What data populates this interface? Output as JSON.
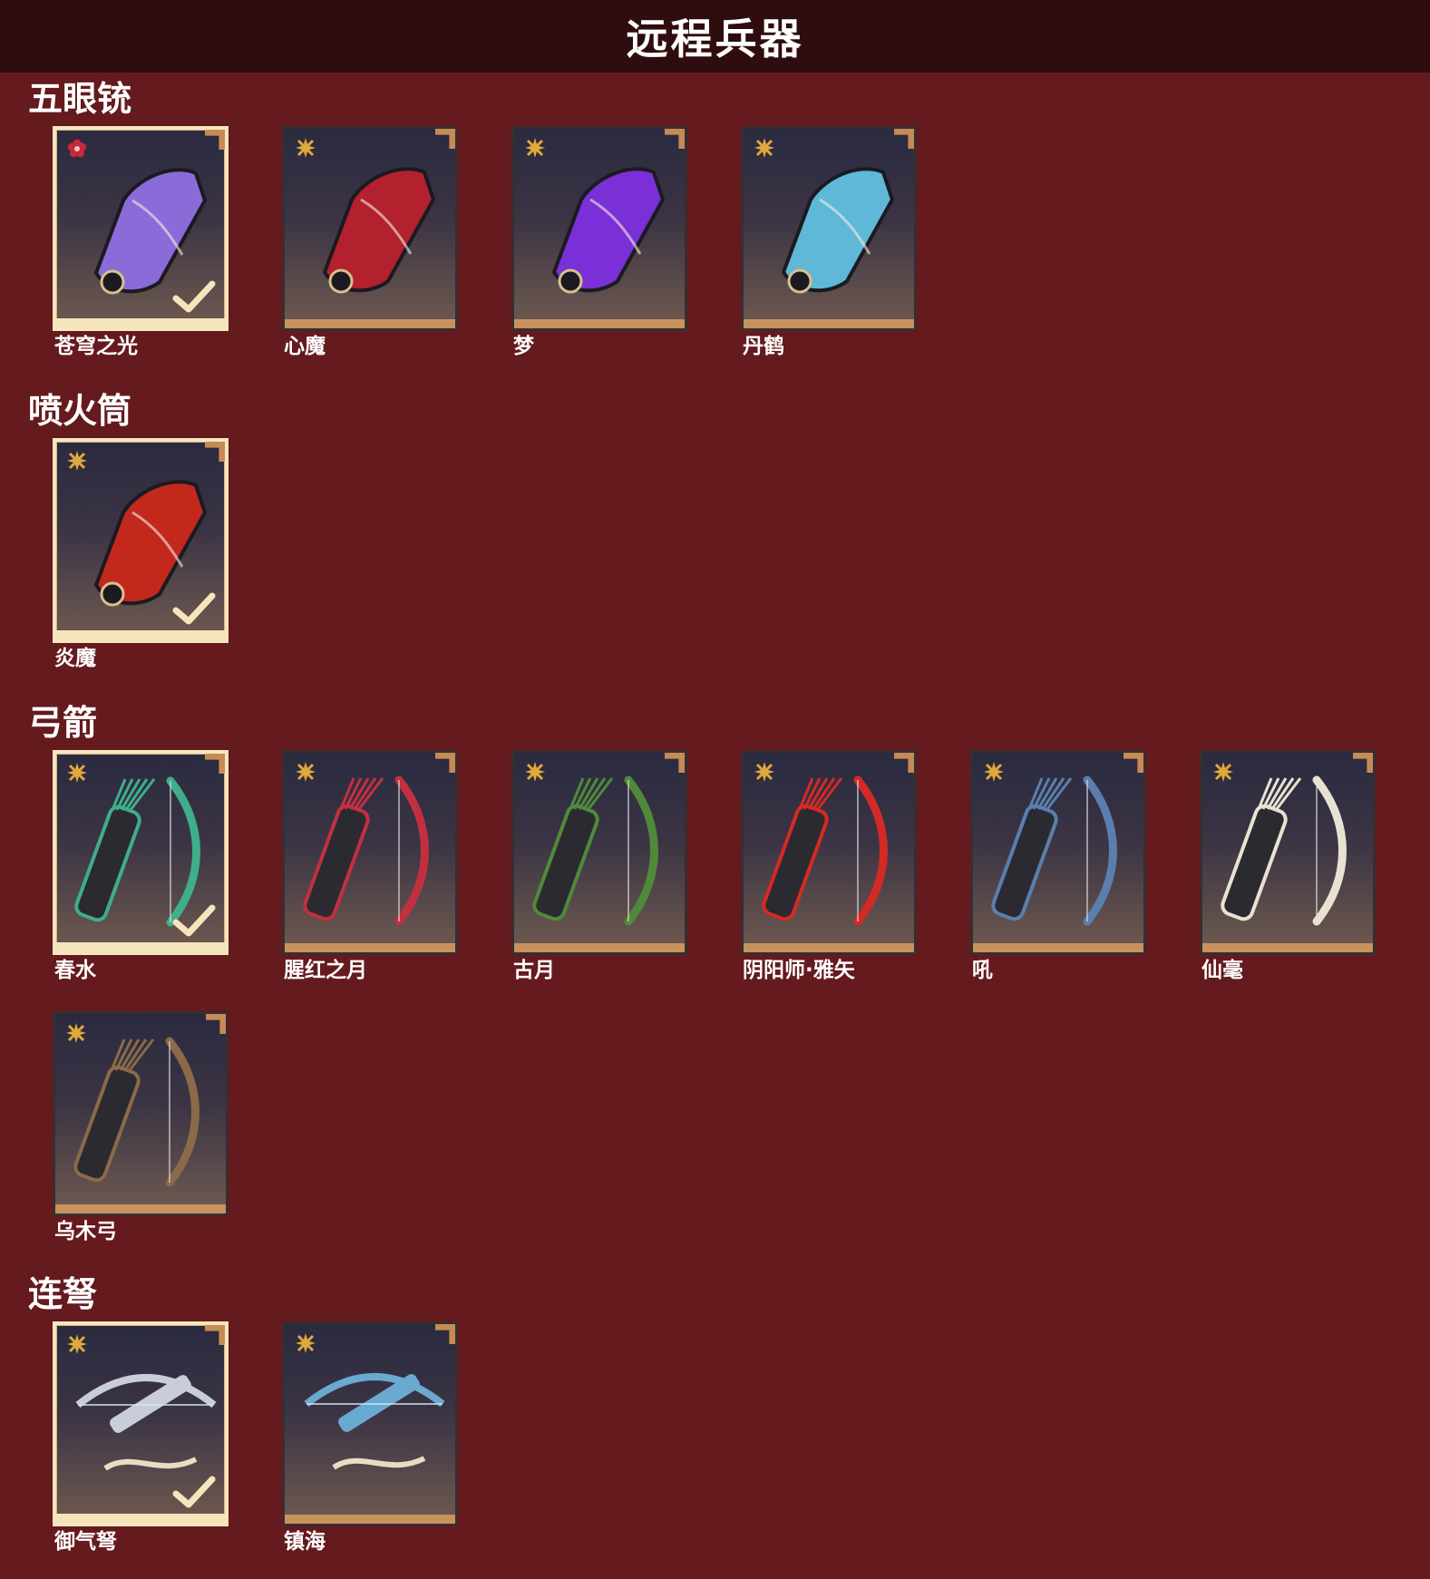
{
  "page": {
    "title": "远程兵器"
  },
  "colors": {
    "background": "#651a1e",
    "header": "#2f0d0f",
    "tile_bar": "#c9925c",
    "equipped_border": "#f5e6c0"
  },
  "sections": [
    {
      "title": "五眼铳",
      "items": [
        {
          "name": "苍穹之光",
          "equipped": true,
          "rarity_icon": "red-flower-icon",
          "art_color": "#8a6bd8"
        },
        {
          "name": "心魔",
          "equipped": false,
          "rarity_icon": "gold-star-icon",
          "art_color": "#b3202e"
        },
        {
          "name": "梦",
          "equipped": false,
          "rarity_icon": "gold-star-icon",
          "art_color": "#7b2fd6"
        },
        {
          "name": "丹鹤",
          "equipped": false,
          "rarity_icon": "gold-star-icon",
          "art_color": "#5fb8d8"
        }
      ]
    },
    {
      "title": "喷火筒",
      "items": [
        {
          "name": "炎魔",
          "equipped": true,
          "rarity_icon": "gold-star-icon",
          "art_color": "#c2281c"
        }
      ]
    },
    {
      "title": "弓箭",
      "items": [
        {
          "name": "春水",
          "equipped": true,
          "rarity_icon": "gold-star-icon",
          "art_color": "#3fae8a"
        },
        {
          "name": "腥红之月",
          "equipped": false,
          "rarity_icon": "gold-star-icon",
          "art_color": "#c23040"
        },
        {
          "name": "古月",
          "equipped": false,
          "rarity_icon": "gold-star-icon",
          "art_color": "#4f8a3a"
        },
        {
          "name": "阴阳师·雅矢",
          "equipped": false,
          "rarity_icon": "gold-star-icon",
          "art_color": "#d42a24"
        },
        {
          "name": "吼",
          "equipped": false,
          "rarity_icon": "gold-star-icon",
          "art_color": "#5a7fae"
        },
        {
          "name": "仙毫",
          "equipped": false,
          "rarity_icon": "gold-star-icon",
          "art_color": "#e8e2d2"
        },
        {
          "name": "乌木弓",
          "equipped": false,
          "rarity_icon": "gold-star-icon",
          "art_color": "#8a6a48"
        }
      ]
    },
    {
      "title": "连弩",
      "items": [
        {
          "name": "御气弩",
          "equipped": true,
          "rarity_icon": "gold-star-icon",
          "art_color": "#c9cdd8"
        },
        {
          "name": "镇海",
          "equipped": false,
          "rarity_icon": "gold-star-icon",
          "art_color": "#6aa9d0"
        }
      ]
    }
  ]
}
